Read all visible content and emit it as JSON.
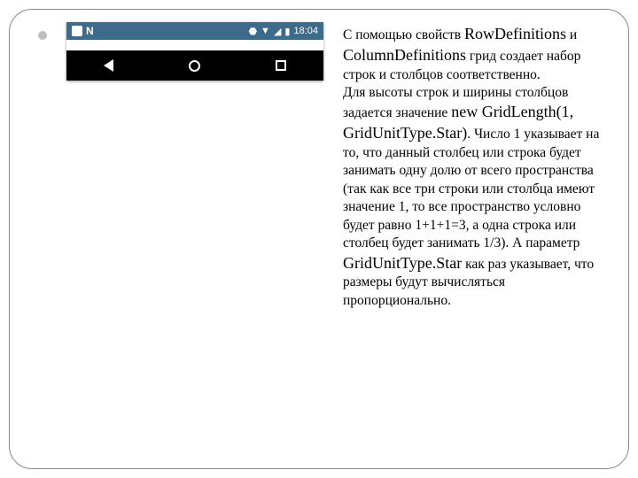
{
  "statusbar": {
    "time": "18:04"
  },
  "grid": {
    "cells": [
      "#e00000",
      "#008282",
      "#808000",
      "#0000ff",
      "#006400",
      "#ff40c0",
      "#d020d0",
      "#800000",
      "#ffff00"
    ]
  },
  "text": {
    "p1a": "С помощью свойств ",
    "p1b": "RowDefinitions",
    "p1c": " и ",
    "p1d": "ColumnDefinitions",
    "p1e": " грид создает набор строк и столбцов соответственно.",
    "p2a": "Для высоты строк и ширины столбцов задается значение ",
    "p2b": "new GridLength(1, GridUnitType.Star)",
    "p2c": ". Число 1 указывает на то, что данный столбец или строка будет занимать одну долю от всего пространства (так как все три строки или столбца имеют значение 1, то все пространство условно будет равно 1+1+1=3, а одна строка или столбец будет занимать 1/3). А параметр ",
    "p2d": "GridUnitType.Star",
    "p2e": " как раз указывает, что размеры будут вычисляться пропорционально."
  }
}
